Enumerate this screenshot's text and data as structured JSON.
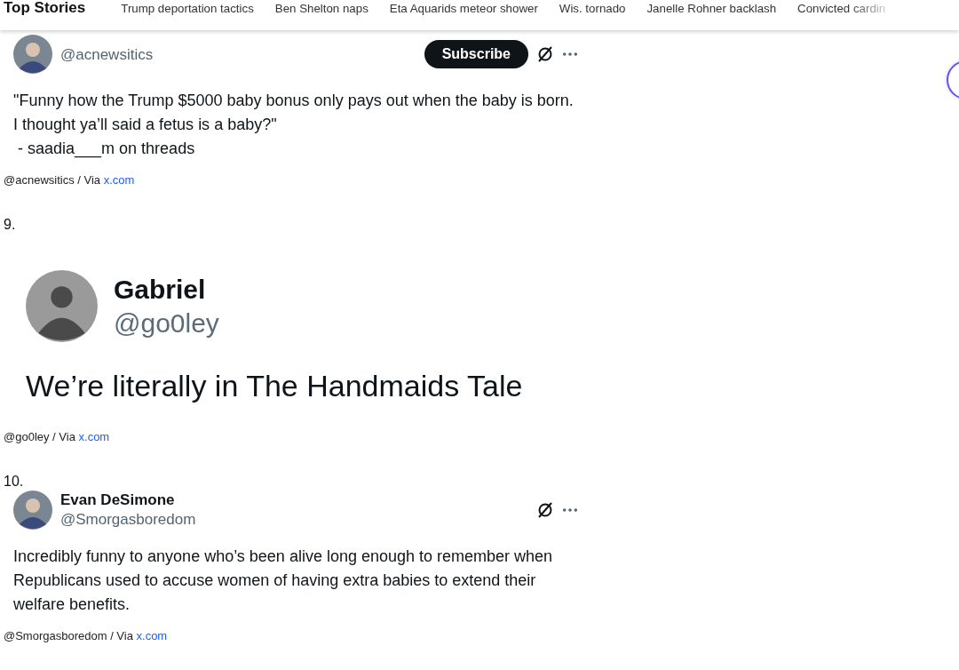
{
  "topnav": {
    "title": "Top Stories",
    "items": [
      "Trump deportation tactics",
      "Ben Shelton naps",
      "Eta Aquarids meteor shower",
      "Wis. tornado",
      "Janelle Rohner backlash",
      "Convicted cardin"
    ]
  },
  "posts": [
    {
      "kind": "tweet",
      "handle": "@acnewsitics",
      "subscribe": "Subscribe",
      "paragraphs": [
        "\"Funny how the Trump $5000 baby bonus only pays out when the baby is born. I thought ya’ll said a fetus is a baby?\"",
        " - saadia___m on threads"
      ],
      "credit": "@acnewsitics / Via ",
      "link": "x.com"
    },
    {
      "number": "9.",
      "kind": "large",
      "name": "Gabriel",
      "handle": "@go0ley",
      "paragraphs": [
        "We’re literally in The Handmaids Tale"
      ],
      "credit": "@go0ley / Via ",
      "link": "x.com"
    },
    {
      "number": "10.",
      "kind": "tweet",
      "name": "Evan DeSimone",
      "handle": "@Smorgasboredom",
      "paragraphs": [
        "Incredibly funny to anyone who’s been alive long enough to remember when Republicans used to accuse women of having extra babies to extend their welfare benefits."
      ],
      "credit": "@Smorgasboredom / Via ",
      "link": "x.com"
    }
  ]
}
